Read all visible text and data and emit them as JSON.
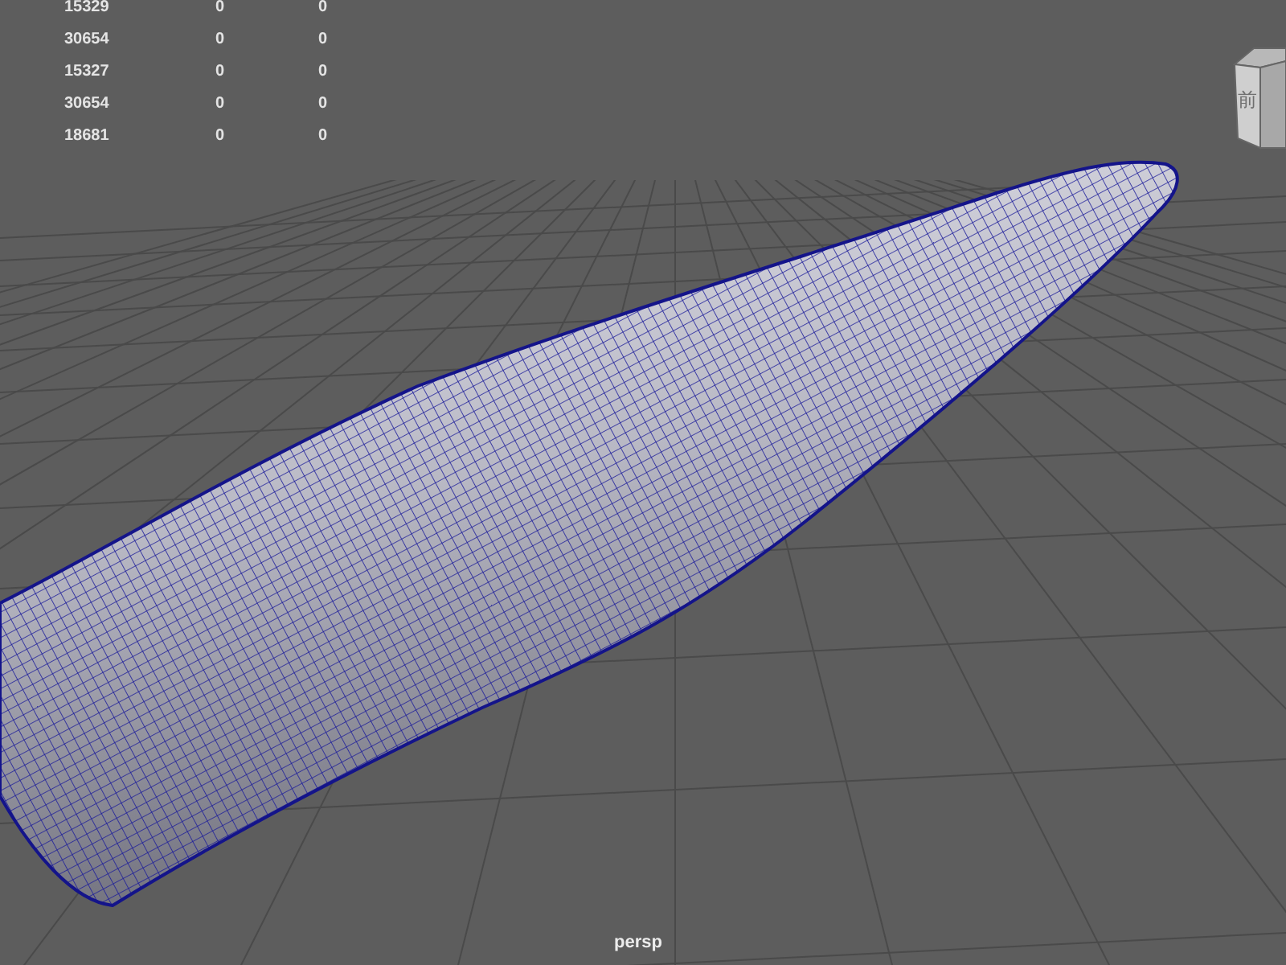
{
  "stats": [
    {
      "column_1": "15329",
      "column_2": "0",
      "column_3": "0"
    },
    {
      "column_1": "30654",
      "column_2": "0",
      "column_3": "0"
    },
    {
      "column_1": "15327",
      "column_2": "0",
      "column_3": "0"
    },
    {
      "column_1": "30654",
      "column_2": "0",
      "column_3": "0"
    },
    {
      "column_1": "18681",
      "column_2": "0",
      "column_3": "0"
    }
  ],
  "view_cube": {
    "label": "前"
  },
  "camera": {
    "label": "persp"
  }
}
